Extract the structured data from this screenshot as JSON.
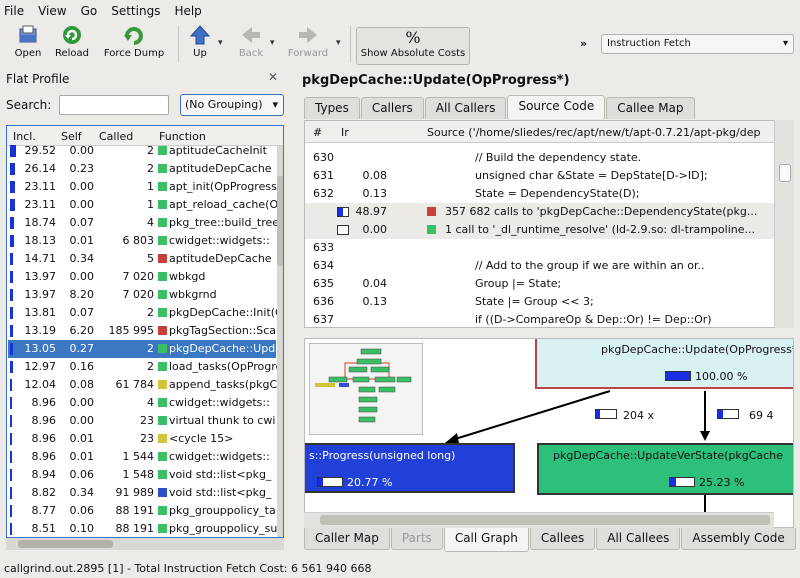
{
  "menu": [
    "File",
    "View",
    "Go",
    "Settings",
    "Help"
  ],
  "toolbar": {
    "open": "Open",
    "reload": "Reload",
    "force_dump": "Force Dump",
    "up": "Up",
    "back": "Back",
    "forward": "Forward",
    "show_absolute": "Show Absolute Costs",
    "show_absolute_glyph": "%",
    "chevron": "»",
    "event_type": "Instruction Fetch"
  },
  "flat": {
    "title": "Flat Profile",
    "search_label": "Search:",
    "search_value": "",
    "grouping": "(No Grouping)",
    "headers": {
      "incl": "Incl.",
      "self": "Self",
      "called": "Called",
      "function": "Function"
    },
    "rows": [
      {
        "incl": "29.52",
        "self": "0.00",
        "called": "2",
        "fn": "aptitudeCacheInit",
        "color": "#3bbf64",
        "frac": 0.3
      },
      {
        "incl": "26.14",
        "self": "0.23",
        "called": "2",
        "fn": "aptitudeDepCache",
        "color": "#3bbf64",
        "frac": 0.26
      },
      {
        "incl": "23.11",
        "self": "0.00",
        "called": "1",
        "fn": "apt_init(OpProgress",
        "color": "#3bbf64",
        "frac": 0.23
      },
      {
        "incl": "23.11",
        "self": "0.00",
        "called": "1",
        "fn": "apt_reload_cache(Op",
        "color": "#3bbf64",
        "frac": 0.23
      },
      {
        "incl": "18.74",
        "self": "0.07",
        "called": "4",
        "fn": "pkg_tree::build_tree",
        "color": "#3bbf64",
        "frac": 0.19
      },
      {
        "incl": "18.13",
        "self": "0.01",
        "called": "6 803",
        "fn": "cwidget::widgets::",
        "color": "#3bbf64",
        "frac": 0.18
      },
      {
        "incl": "14.71",
        "self": "0.34",
        "called": "5",
        "fn": "aptitudeDepCache",
        "color": "#c8423a",
        "frac": 0.15
      },
      {
        "incl": "13.97",
        "self": "0.00",
        "called": "7 020",
        "fn": "wbkgd",
        "color": "#3bbf64",
        "frac": 0.14
      },
      {
        "incl": "13.97",
        "self": "8.20",
        "called": "7 020",
        "fn": "wbkgrnd",
        "color": "#3bbf64",
        "frac": 0.14
      },
      {
        "incl": "13.81",
        "self": "0.07",
        "called": "2",
        "fn": "pkgDepCache::Init(Op",
        "color": "#3bbf64",
        "frac": 0.14
      },
      {
        "incl": "13.19",
        "self": "6.20",
        "called": "185 995",
        "fn": "pkgTagSection::Scan",
        "color": "#c8423a",
        "frac": 0.13
      },
      {
        "incl": "13.05",
        "self": "0.27",
        "called": "2",
        "fn": "pkgDepCache::Update",
        "color": "#3bbf64",
        "frac": 0.13
      },
      {
        "incl": "12.97",
        "self": "0.16",
        "called": "2",
        "fn": "load_tasks(OpProgre",
        "color": "#3bbf64",
        "frac": 0.13
      },
      {
        "incl": "12.04",
        "self": "0.08",
        "called": "61 784",
        "fn": "append_tasks(pkgCa",
        "color": "#d2c53a",
        "frac": 0.12
      },
      {
        "incl": "8.96",
        "self": "0.00",
        "called": "4",
        "fn": "cwidget::widgets::",
        "color": "#3bbf64",
        "frac": 0.09
      },
      {
        "incl": "8.96",
        "self": "0.00",
        "called": "23",
        "fn": "virtual thunk to cwi",
        "color": "#3bbf64",
        "frac": 0.09
      },
      {
        "incl": "8.96",
        "self": "0.01",
        "called": "23",
        "fn": "<cycle 15>",
        "color": "#d2c53a",
        "frac": 0.09
      },
      {
        "incl": "8.96",
        "self": "0.01",
        "called": "1 544",
        "fn": "cwidget::widgets::",
        "color": "#3bbf64",
        "frac": 0.09
      },
      {
        "incl": "8.94",
        "self": "0.06",
        "called": "1 548",
        "fn": "void std::list<pkg_",
        "color": "#3bbf64",
        "frac": 0.09
      },
      {
        "incl": "8.82",
        "self": "0.34",
        "called": "91 989",
        "fn": "void std::list<pkg_",
        "color": "#2d4fc9",
        "frac": 0.09
      },
      {
        "incl": "8.77",
        "self": "0.06",
        "called": "88 191",
        "fn": "pkg_grouppolicy_ta",
        "color": "#3bbf64",
        "frac": 0.09
      },
      {
        "incl": "8.51",
        "self": "0.10",
        "called": "88 191",
        "fn": "pkg_grouppolicy_su",
        "color": "#3bbf64",
        "frac": 0.09
      }
    ]
  },
  "detail": {
    "title": "pkgDepCache::Update(OpProgress*)",
    "top_tabs": [
      "Types",
      "Callers",
      "All Callers",
      "Source Code",
      "Callee Map"
    ],
    "src_headers": {
      "hash": "#",
      "ir": "Ir",
      "source": "Source ('/home/sliedes/rec/apt/new/t/apt-0.7.21/apt-pkg/dep"
    },
    "src_rows": [
      {
        "line": "630",
        "ir": "",
        "code": "// Build the dependency state."
      },
      {
        "line": "631",
        "ir": "0.08",
        "code": "unsigned char &State = DepState[D->ID];"
      },
      {
        "line": "632",
        "ir": "0.13",
        "code": "State = DependencyState(D);"
      },
      {
        "line": "",
        "ir": "48.97",
        "code": "357 682 calls to 'pkgDepCache::DependencyState(pkg...",
        "call": true,
        "color": "#c8423a",
        "frac": 0.49
      },
      {
        "line": "",
        "ir": "0.00",
        "code": "1 call to '_dl_runtime_resolve' (ld-2.9.so: dl-trampoline...",
        "call": true,
        "color": "#3bbf64",
        "frac": 0.0
      },
      {
        "line": "633",
        "ir": "",
        "code": ""
      },
      {
        "line": "634",
        "ir": "",
        "code": "// Add to the group if we are within an or.."
      },
      {
        "line": "635",
        "ir": "0.04",
        "code": "Group |= State;"
      },
      {
        "line": "636",
        "ir": "0.13",
        "code": "State |= Group << 3;"
      },
      {
        "line": "637",
        "ir": "",
        "code": "if ((D->CompareOp & Dep::Or) != Dep::Or)"
      }
    ],
    "graph": {
      "main_node": "pkgDepCache::Update(OpProgress*)",
      "main_pct": "100.00 %",
      "main_frac": 1.0,
      "edge_left": "204 x",
      "edge_right": "69 4",
      "left_node": "s::Progress(unsigned long)",
      "left_pct": "20.77 %",
      "left_frac": 0.21,
      "right_node": "pkgDepCache::UpdateVerState(pkgCache",
      "right_pct": "25.23 %",
      "right_frac": 0.25
    },
    "bottom_tabs": [
      "Caller Map",
      "Parts",
      "Call Graph",
      "Callees",
      "All Callees",
      "Assembly Code"
    ]
  },
  "status": "callgrind.out.2895 [1] - Total Instruction Fetch Cost:  6 561 940 668"
}
